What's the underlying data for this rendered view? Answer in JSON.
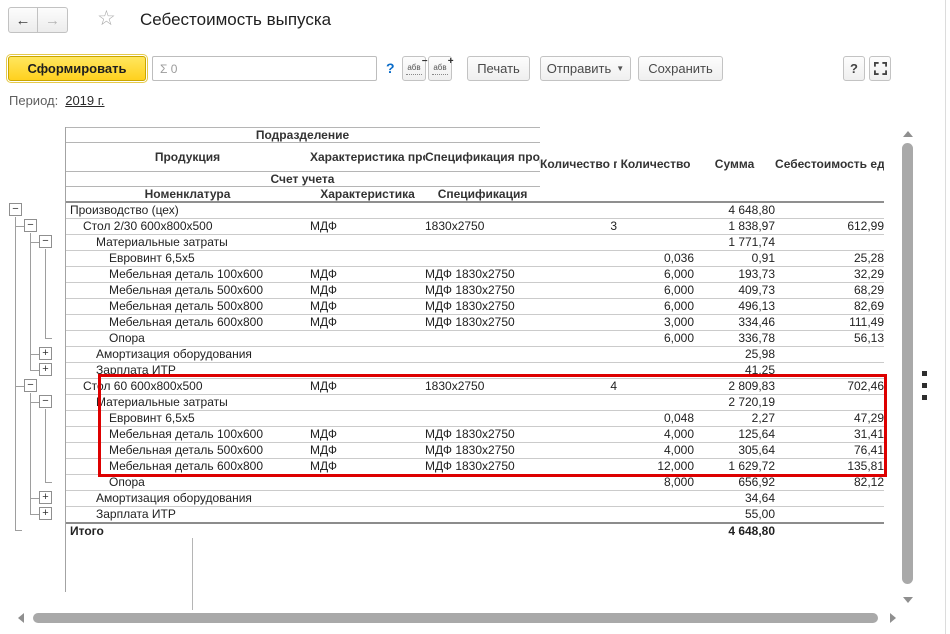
{
  "window": {
    "title": "Себестоимость выпуска"
  },
  "nav": {
    "back_icon": "←",
    "forward_icon": "→",
    "favorite_star_icon": "☆"
  },
  "toolbar": {
    "generate_label": "Сформировать",
    "sum_field_value": "Σ 0",
    "help_link": "?",
    "collapse_groups_icon": {
      "letters": "абв",
      "sign": "−"
    },
    "expand_groups_icon": {
      "letters": "абв",
      "sign": "+"
    },
    "print_label": "Печать",
    "send_label": "Отправить",
    "send_caret": "▼",
    "save_label": "Сохранить",
    "help_button": "?"
  },
  "period": {
    "label": "Период:",
    "value": "2019 г."
  },
  "report_table": {
    "header": {
      "group_row1": "Подразделение",
      "row2": [
        "Продукция",
        "Характеристика продукции",
        "Спецификация продукции"
      ],
      "group_row3": "Счет учета",
      "row4": [
        "Номенклатура",
        "Характеристика",
        "Спецификация"
      ],
      "value_columns": [
        "Количество продукции",
        "Количество",
        "Сумма",
        "Себестоимость ед."
      ]
    },
    "highlight_box_color": "#dd0000",
    "rows": [
      {
        "level": 0,
        "toggle": "minus",
        "name": "Производство (цех)",
        "characteristic": "",
        "specification": "",
        "qty_products": "",
        "qty": "",
        "sum": "4 648,80",
        "unit_cost": "",
        "highlighted": false
      },
      {
        "level": 1,
        "toggle": "minus",
        "name": "Стол 2/30 600x800x500",
        "characteristic": "МДФ",
        "specification": "1830x2750",
        "qty_products": "3",
        "qty": "",
        "sum": "1 838,97",
        "unit_cost": "612,99",
        "highlighted": false
      },
      {
        "level": 2,
        "toggle": "minus",
        "name": "Материальные затраты",
        "characteristic": "",
        "specification": "",
        "qty_products": "",
        "qty": "",
        "sum": "1 771,74",
        "unit_cost": "",
        "highlighted": false
      },
      {
        "level": 3,
        "toggle": null,
        "name": "Евровинт 6,5x5",
        "characteristic": "",
        "specification": "",
        "qty_products": "",
        "qty": "0,036",
        "sum": "0,91",
        "unit_cost": "25,28",
        "highlighted": true
      },
      {
        "level": 3,
        "toggle": null,
        "name": "Мебельная деталь 100x600",
        "characteristic": "МДФ",
        "specification": "МДФ 1830x2750",
        "qty_products": "",
        "qty": "6,000",
        "sum": "193,73",
        "unit_cost": "32,29",
        "highlighted": true
      },
      {
        "level": 3,
        "toggle": null,
        "name": "Мебельная деталь 500x600",
        "characteristic": "МДФ",
        "specification": "МДФ 1830x2750",
        "qty_products": "",
        "qty": "6,000",
        "sum": "409,73",
        "unit_cost": "68,29",
        "highlighted": true
      },
      {
        "level": 3,
        "toggle": null,
        "name": "Мебельная деталь 500x800",
        "characteristic": "МДФ",
        "specification": "МДФ 1830x2750",
        "qty_products": "",
        "qty": "6,000",
        "sum": "496,13",
        "unit_cost": "82,69",
        "highlighted": true
      },
      {
        "level": 3,
        "toggle": null,
        "name": "Мебельная деталь 600x800",
        "characteristic": "МДФ",
        "specification": "МДФ 1830x2750",
        "qty_products": "",
        "qty": "3,000",
        "sum": "334,46",
        "unit_cost": "111,49",
        "highlighted": true
      },
      {
        "level": 3,
        "toggle": null,
        "name": "Опора",
        "characteristic": "",
        "specification": "",
        "qty_products": "",
        "qty": "6,000",
        "sum": "336,78",
        "unit_cost": "56,13",
        "highlighted": true
      },
      {
        "level": 2,
        "toggle": "plus",
        "name": "Амортизация оборудования",
        "characteristic": "",
        "specification": "",
        "qty_products": "",
        "qty": "",
        "sum": "25,98",
        "unit_cost": "",
        "highlighted": false
      },
      {
        "level": 2,
        "toggle": "plus",
        "name": "Зарплата ИТР",
        "characteristic": "",
        "specification": "",
        "qty_products": "",
        "qty": "",
        "sum": "41,25",
        "unit_cost": "",
        "highlighted": false
      },
      {
        "level": 1,
        "toggle": "minus",
        "name": "Стол 60 600x800x500",
        "characteristic": "МДФ",
        "specification": "1830x2750",
        "qty_products": "4",
        "qty": "",
        "sum": "2 809,83",
        "unit_cost": "702,46",
        "highlighted": false
      },
      {
        "level": 2,
        "toggle": "minus",
        "name": "Материальные затраты",
        "characteristic": "",
        "specification": "",
        "qty_products": "",
        "qty": "",
        "sum": "2 720,19",
        "unit_cost": "",
        "highlighted": false
      },
      {
        "level": 3,
        "toggle": null,
        "name": "Евровинт 6,5x5",
        "characteristic": "",
        "specification": "",
        "qty_products": "",
        "qty": "0,048",
        "sum": "2,27",
        "unit_cost": "47,29",
        "highlighted": false
      },
      {
        "level": 3,
        "toggle": null,
        "name": "Мебельная деталь 100x600",
        "characteristic": "МДФ",
        "specification": "МДФ 1830x2750",
        "qty_products": "",
        "qty": "4,000",
        "sum": "125,64",
        "unit_cost": "31,41",
        "highlighted": false
      },
      {
        "level": 3,
        "toggle": null,
        "name": "Мебельная деталь 500x600",
        "characteristic": "МДФ",
        "specification": "МДФ 1830x2750",
        "qty_products": "",
        "qty": "4,000",
        "sum": "305,64",
        "unit_cost": "76,41",
        "highlighted": false
      },
      {
        "level": 3,
        "toggle": null,
        "name": "Мебельная деталь 600x800",
        "characteristic": "МДФ",
        "specification": "МДФ 1830x2750",
        "qty_products": "",
        "qty": "12,000",
        "sum": "1 629,72",
        "unit_cost": "135,81",
        "highlighted": false
      },
      {
        "level": 3,
        "toggle": null,
        "name": "Опора",
        "characteristic": "",
        "specification": "",
        "qty_products": "",
        "qty": "8,000",
        "sum": "656,92",
        "unit_cost": "82,12",
        "highlighted": false
      },
      {
        "level": 2,
        "toggle": "plus",
        "name": "Амортизация оборудования",
        "characteristic": "",
        "specification": "",
        "qty_products": "",
        "qty": "",
        "sum": "34,64",
        "unit_cost": "",
        "highlighted": false
      },
      {
        "level": 2,
        "toggle": "plus",
        "name": "Зарплата ИТР",
        "characteristic": "",
        "specification": "",
        "qty_products": "",
        "qty": "",
        "sum": "55,00",
        "unit_cost": "",
        "highlighted": false
      },
      {
        "level": 0,
        "toggle": null,
        "name": "Итого",
        "characteristic": "",
        "specification": "",
        "qty_products": "",
        "qty": "",
        "sum": "4 648,80",
        "unit_cost": "",
        "highlighted": false,
        "total": true
      }
    ]
  }
}
